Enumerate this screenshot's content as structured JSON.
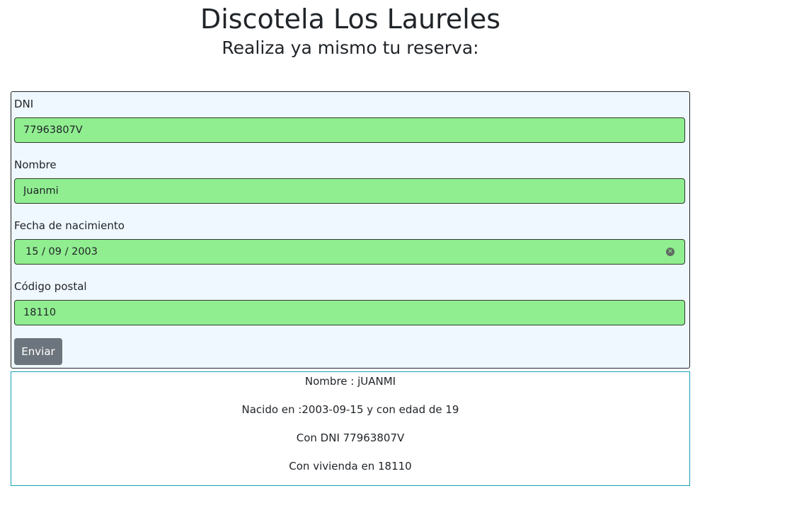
{
  "header": {
    "title": "Discotela Los Laureles",
    "subtitle": "Realiza ya mismo tu reserva:"
  },
  "form": {
    "dni": {
      "label": "DNI",
      "value": "77963807V"
    },
    "nombre": {
      "label": "Nombre",
      "value": "Juanmi"
    },
    "fecha": {
      "label": "Fecha de nacimiento",
      "value": "15 / 09 / 2003"
    },
    "codigo_postal": {
      "label": "Código postal",
      "value": "18110"
    },
    "submit_label": "Enviar",
    "field_color": "#90ee90",
    "background_color": "#f0f8ff"
  },
  "result": {
    "nombre": "Nombre : jUANMI",
    "nacido": "Nacido en :2003-09-15 y con edad de 19",
    "dni": "Con DNI 77963807V",
    "vivienda": "Con vivienda en 18110",
    "border_color": "#17a2b8"
  },
  "icons": {
    "date_clear": "clear-icon"
  }
}
